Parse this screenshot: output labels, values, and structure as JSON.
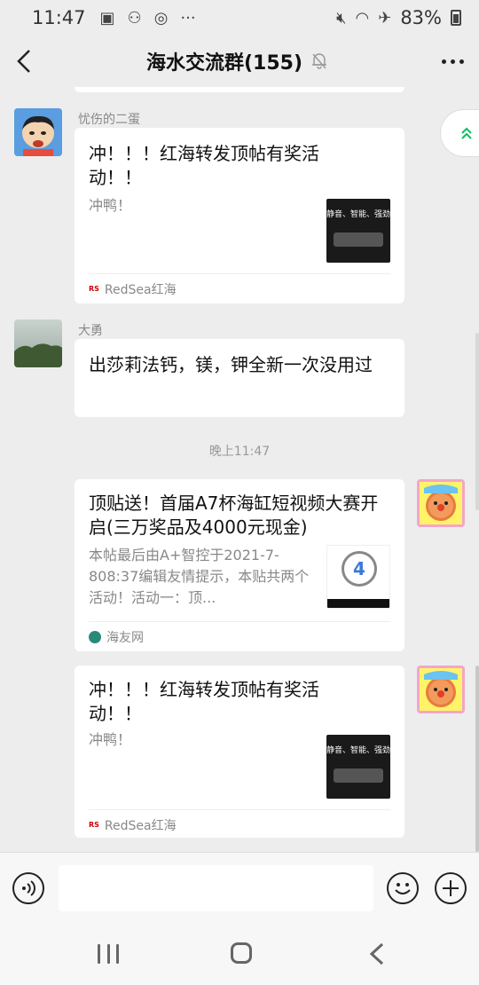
{
  "status_bar": {
    "time": "11:47",
    "battery": "83%"
  },
  "header": {
    "title": "海水交流群(155)"
  },
  "messages": [
    {
      "sender": "忧伤的二蛋",
      "card": {
        "title": "冲！！！红海转发顶帖有奖活动！！",
        "desc": "冲鸭！",
        "thumb_text": "静音、智能、强劲",
        "source": "RedSea红海"
      }
    },
    {
      "sender": "大勇",
      "text": "出莎莉法钙，镁，钾全新一次没用过"
    },
    {
      "card": {
        "title": "顶贴送！首届A7杯海缸短视频大赛开启(三万奖品及4000元现金)",
        "desc": "本帖最后由A+智控于2021-7-808:37编辑友情提示，本贴共两个活动！活动一：顶...",
        "source": "海友网"
      }
    },
    {
      "card": {
        "title": "冲！！！红海转发顶帖有奖活动！！",
        "desc": "冲鸭！",
        "thumb_text": "静音、智能、强劲",
        "source": "RedSea红海"
      }
    }
  ],
  "time_separator": "晚上11:47",
  "colors": {
    "background": "#ededed",
    "bubble": "#ffffff",
    "accent_green": "#07c160"
  }
}
